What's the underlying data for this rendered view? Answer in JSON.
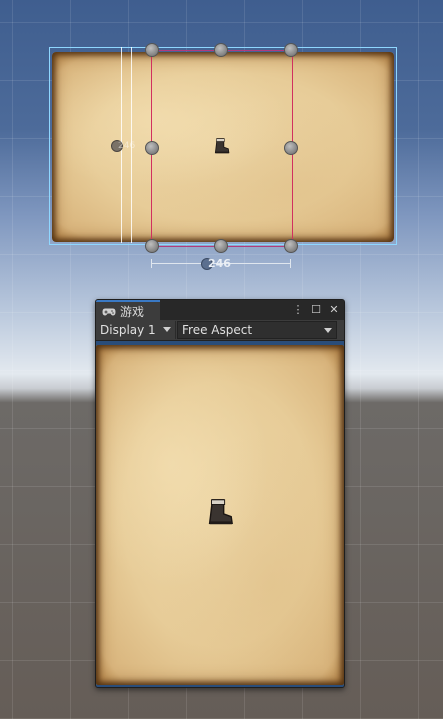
{
  "scene": {
    "width_label": "246",
    "left_label": "246"
  },
  "game_window": {
    "tab_label": "游戏",
    "tab_icon": "gamepad-icon",
    "controls": {
      "menu": "⋮",
      "maximize": "☐",
      "close": "✕"
    },
    "display_select": "Display 1",
    "aspect_select": "Free Aspect"
  },
  "colors": {
    "tab_accent": "#3a79c4",
    "rect_tool": "#d1305f",
    "selection_border": "#8fd7ff"
  }
}
